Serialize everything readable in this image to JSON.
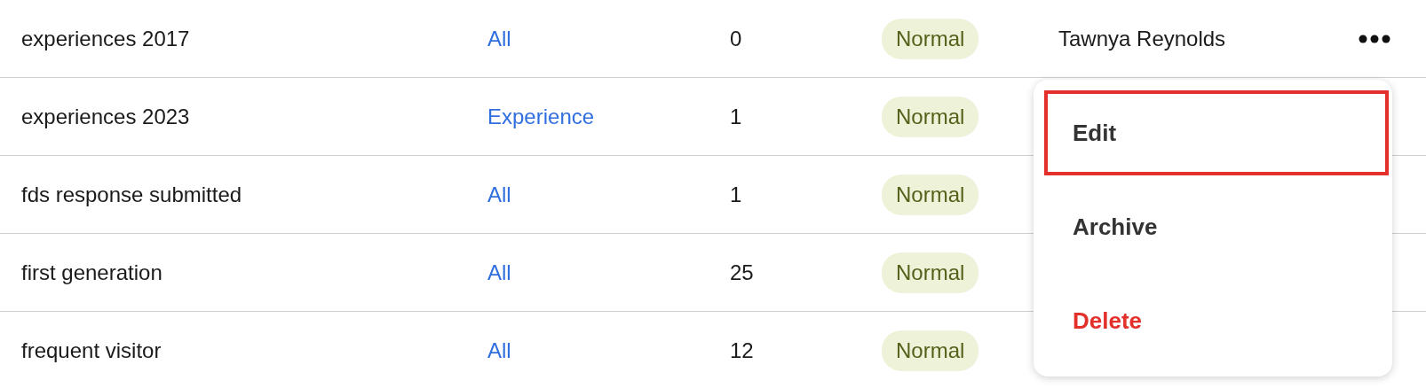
{
  "rows": [
    {
      "name": "experiences 2017",
      "type": "All",
      "count": "0",
      "status": "Normal",
      "owner": "Tawnya Reynolds"
    },
    {
      "name": "experiences 2023",
      "type": "Experience",
      "count": "1",
      "status": "Normal"
    },
    {
      "name": "fds response submitted",
      "type": "All",
      "count": "1",
      "status": "Normal"
    },
    {
      "name": "first generation",
      "type": "All",
      "count": "25",
      "status": "Normal"
    },
    {
      "name": "frequent visitor",
      "type": "All",
      "count": "12",
      "status": "Normal"
    }
  ],
  "row_menu": {
    "items": [
      {
        "label": "Edit",
        "kind": "normal",
        "selected": true
      },
      {
        "label": "Archive",
        "kind": "normal",
        "selected": false
      },
      {
        "label": "Delete",
        "kind": "danger",
        "selected": false
      }
    ]
  }
}
